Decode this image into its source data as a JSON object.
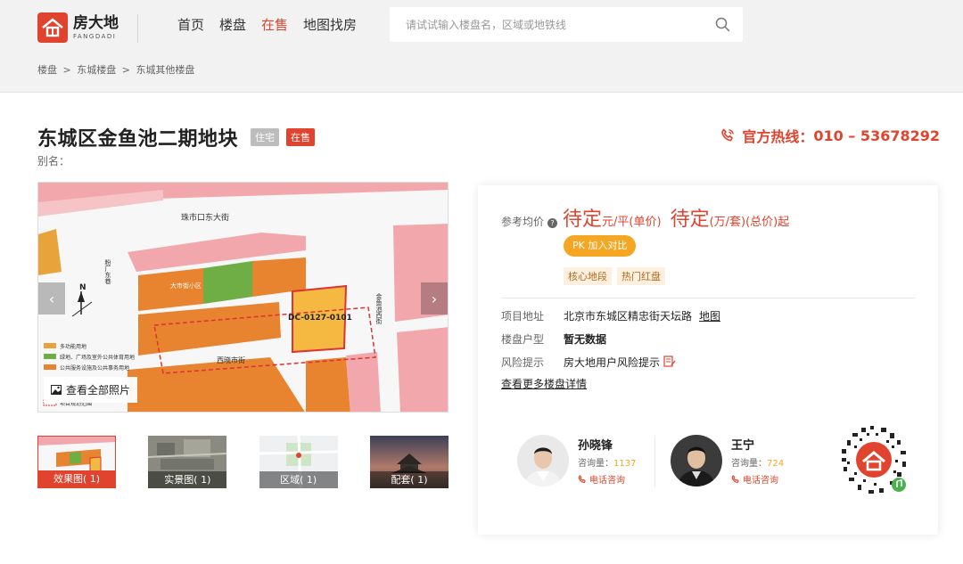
{
  "brand": {
    "name_cn": "房大地",
    "name_en": "FANGDADI"
  },
  "nav": [
    {
      "label": "首页",
      "active": false
    },
    {
      "label": "楼盘",
      "active": false
    },
    {
      "label": "在售",
      "active": true
    },
    {
      "label": "地图找房",
      "active": false
    }
  ],
  "search": {
    "placeholder": "请试试输入楼盘名，区域或地铁线"
  },
  "breadcrumb": [
    "楼盘",
    "东城楼盘",
    "东城其他楼盘"
  ],
  "breadcrumb_sep": ">",
  "property": {
    "title": "东城区金鱼池二期地块",
    "tags": [
      "住宅",
      "在售"
    ],
    "alias_label": "别名："
  },
  "hotline": {
    "label": "官方热线：",
    "number": "010 – 53678292"
  },
  "gallery": {
    "view_all": "查看全部照片",
    "prev": "‹",
    "next": "›",
    "map_labels": {
      "street_top": "珠市口东大街",
      "street_bottom": "西晓市街",
      "street_left": "粉厂东巷",
      "street_right": "金鱼池西街",
      "plot_code": "DC-0127-0101",
      "lane": "大市街小区",
      "north": "N",
      "legend": [
        "多功能用地",
        "绿地、广场及室外公共体育用地",
        "公共服务设施及公共事务用地",
        "项目规划范围"
      ]
    },
    "thumbs": [
      {
        "label": "效果图( 1)",
        "active": true
      },
      {
        "label": "实景图( 1)",
        "active": false
      },
      {
        "label": "区域( 1)",
        "active": false
      },
      {
        "label": "配套( 1)",
        "active": false
      }
    ]
  },
  "card": {
    "price_label": "参考均价",
    "price_help": "?",
    "unit_price_value": "待定",
    "unit_price_unit": "元/平(单价)",
    "total_price_value": "待定",
    "total_price_unit": "(万/套)(总价)起",
    "compare_button": "PK 加入对比",
    "feature_tags": [
      "核心地段",
      "热门红盘"
    ],
    "rows": [
      {
        "key": "项目地址",
        "value": "北京市东城区精忠街天坛路",
        "link": "地图"
      },
      {
        "key": "楼盘户型",
        "value": "暂无数据"
      },
      {
        "key": "风险提示",
        "value": "房大地用户风险提示"
      }
    ],
    "more_link": "查看更多楼盘详情",
    "agents": [
      {
        "name": "孙晓锋",
        "count_label": "咨询量：",
        "count": "1137",
        "call": "电话咨询"
      },
      {
        "name": "王宁",
        "count_label": "咨询量：",
        "count": "724",
        "call": "电话咨询"
      }
    ]
  },
  "colors": {
    "brand_red": "#e0442e",
    "accent_orange": "#f5a623",
    "header_bg": "#f2f2f2"
  }
}
